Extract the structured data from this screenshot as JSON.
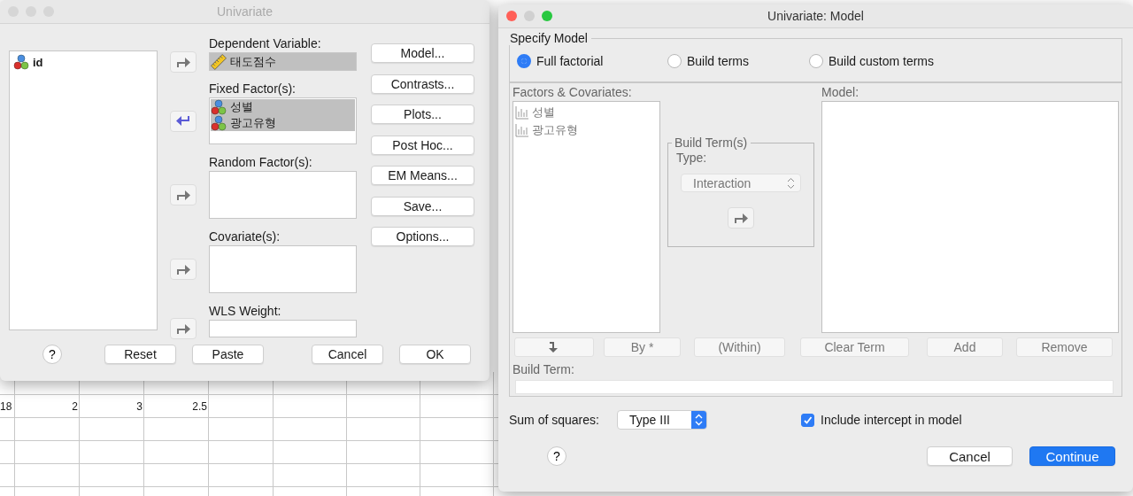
{
  "data_sheet": {
    "rows": [
      {
        "cells": [
          "18",
          "2",
          "3",
          "2.5"
        ]
      }
    ]
  },
  "univariate_dialog": {
    "title": "Univariate",
    "active": false,
    "variables": [
      {
        "name": "id",
        "kind": "nominal"
      }
    ],
    "dependent_variable": {
      "label": "Dependent Variable:",
      "kind": "right_arrow",
      "items": [
        {
          "name": "태도점수",
          "kind": "scale"
        }
      ]
    },
    "fixed_factors": {
      "label": "Fixed Factor(s):",
      "kind": "left_arrow",
      "items": [
        {
          "name": "성별",
          "kind": "nominal"
        },
        {
          "name": "광고유형",
          "kind": "nominal"
        }
      ]
    },
    "random_factors": {
      "label": "Random Factor(s):",
      "kind": "right_arrow"
    },
    "covariates": {
      "label": "Covariate(s):",
      "kind": "right_arrow"
    },
    "wls_weight": {
      "label": "WLS Weight:",
      "kind": "right_arrow"
    },
    "side_buttons": [
      "Model...",
      "Contrasts...",
      "Plots...",
      "Post Hoc...",
      "EM Means...",
      "Save...",
      "Options..."
    ],
    "help": "?",
    "footer_buttons": [
      "Reset",
      "Paste",
      "Cancel",
      "OK"
    ]
  },
  "model_dialog": {
    "title": "Univariate: Model",
    "active": true,
    "specify_model": {
      "label": "Specify Model",
      "options": [
        {
          "label": "Full factorial",
          "selected": true
        },
        {
          "label": "Build terms",
          "selected": false
        },
        {
          "label": "Build custom terms",
          "selected": false
        }
      ]
    },
    "factors_covariates": {
      "label": "Factors & Covariates:",
      "items": [
        {
          "name": "성별",
          "kind": "nominal"
        },
        {
          "name": "광고유형",
          "kind": "nominal"
        }
      ]
    },
    "build_terms": {
      "label": "Build Term(s)",
      "type_label": "Type:",
      "type_value": "Interaction",
      "disabled": true
    },
    "model": {
      "label": "Model:"
    },
    "term_buttons": [
      {
        "kind": "arrow",
        "disabled": true
      },
      {
        "kind": "text",
        "label": "By *",
        "disabled": true
      },
      {
        "kind": "text",
        "label": "(Within)",
        "disabled": true
      },
      {
        "kind": "text",
        "label": "Clear Term",
        "disabled": true
      },
      {
        "kind": "text",
        "label": "Add",
        "disabled": true
      },
      {
        "kind": "text",
        "label": "Remove",
        "disabled": true
      }
    ],
    "build_term": {
      "label": "Build Term:"
    },
    "sum_of_squares": {
      "label": "Sum of squares:",
      "value": "Type III"
    },
    "include_intercept": {
      "label": "Include intercept in model",
      "checked": true
    },
    "help": "?",
    "buttons": [
      {
        "label": "Cancel",
        "default": false
      },
      {
        "label": "Continue",
        "default": true
      }
    ]
  }
}
